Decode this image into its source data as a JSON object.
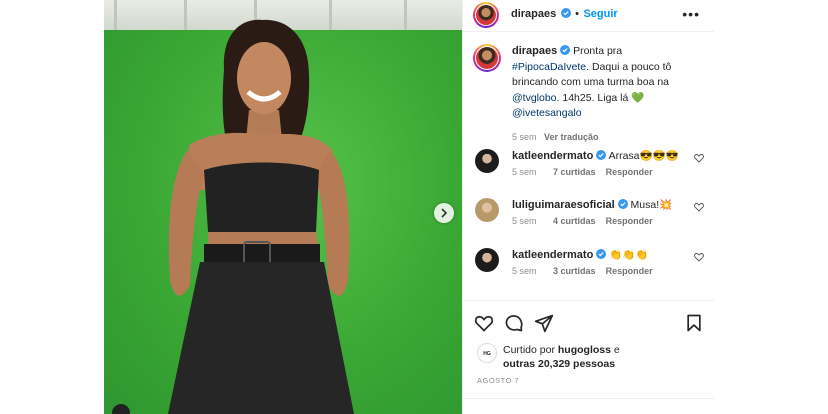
{
  "post": {
    "username": "dirapaes",
    "follow_label": "Seguir",
    "more_label": "•••",
    "caption": {
      "author": "dirapaes",
      "text_1": "Pronta pra",
      "hashtag": "#PipocaDaIvete",
      "text_2": ". Daqui a pouco tô brincando com uma turma boa na",
      "mention_1": "@tvglobo",
      "text_3": ". 14h25. Liga lá 💚",
      "mention_2": "@ivetesangalo",
      "time": "5 sem",
      "translate_label": "Ver tradução"
    },
    "comments": [
      {
        "author": "katleendermato",
        "text": "Arrasa😎😎😎",
        "time": "5 sem",
        "likes": "7 curtidas",
        "reply": "Responder"
      },
      {
        "author": "luliguimaraesoficial",
        "text": "Musa!💥",
        "time": "5 sem",
        "likes": "4 curtidas",
        "reply": "Responder"
      },
      {
        "author": "katleendermato",
        "text": "👏👏👏",
        "time": "5 sem",
        "likes": "3 curtidas",
        "reply": "Responder"
      }
    ],
    "likes": {
      "prefix": "Curtido por",
      "user": "hugogloss",
      "connector": "e",
      "others": "outras 20,329 pessoas"
    },
    "date": "AGOSTO 7"
  },
  "colors": {
    "accent": "#0095f6",
    "link": "#00376b",
    "green_screen": "#3fae3a",
    "verified": "#3897f0"
  },
  "icons": [
    "verified-icon",
    "more-options-icon",
    "chevron-right-icon",
    "heart-icon",
    "comment-icon",
    "share-icon",
    "bookmark-icon"
  ]
}
